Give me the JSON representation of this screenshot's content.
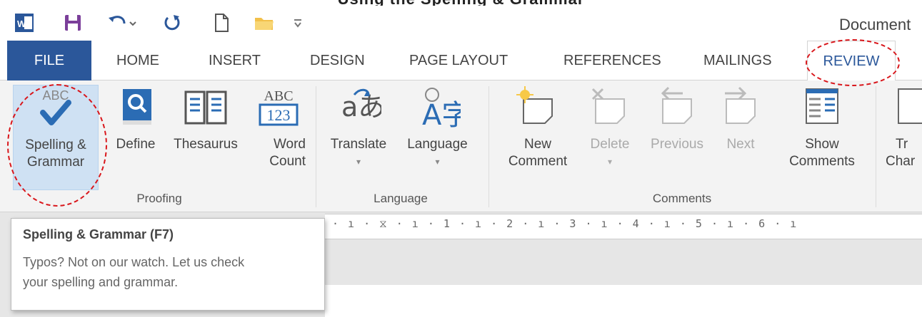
{
  "caption": "Using the Spelling & Grammar",
  "document_title": "Document",
  "tabs": [
    "FILE",
    "HOME",
    "INSERT",
    "DESIGN",
    "PAGE LAYOUT",
    "REFERENCES",
    "MAILINGS",
    "REVIEW"
  ],
  "active_tab": "REVIEW",
  "accent_color": "#2b579a",
  "annotation_color": "#d9161b",
  "proofing": {
    "label": "Proofing",
    "spelling": [
      "Spelling &",
      "Grammar"
    ],
    "spelling_icon_text": "ABC",
    "define": "Define",
    "thesaurus": "Thesaurus",
    "word_count": [
      "Word",
      "Count"
    ],
    "word_count_icon": [
      "ABC",
      "123"
    ]
  },
  "language": {
    "label": "Language",
    "translate": "Translate",
    "language": "Language",
    "translate_icon": "aあ",
    "language_icon": "A字"
  },
  "comments": {
    "label": "Comments",
    "new": [
      "New",
      "Comment"
    ],
    "delete": "Delete",
    "previous": "Previous",
    "next": "Next",
    "show": [
      "Show",
      "Comments"
    ]
  },
  "tracking": [
    "Tr",
    "Char"
  ],
  "ruler_text": "· ı · ⧖ · ı · 1 · ı · 2 · ı · 3 · ı · 4 · ı · 5 · ı · 6 · ı",
  "tooltip": {
    "title": "Spelling & Grammar (F7)",
    "body": "Typos? Not on our watch. Let us check your spelling and grammar."
  }
}
